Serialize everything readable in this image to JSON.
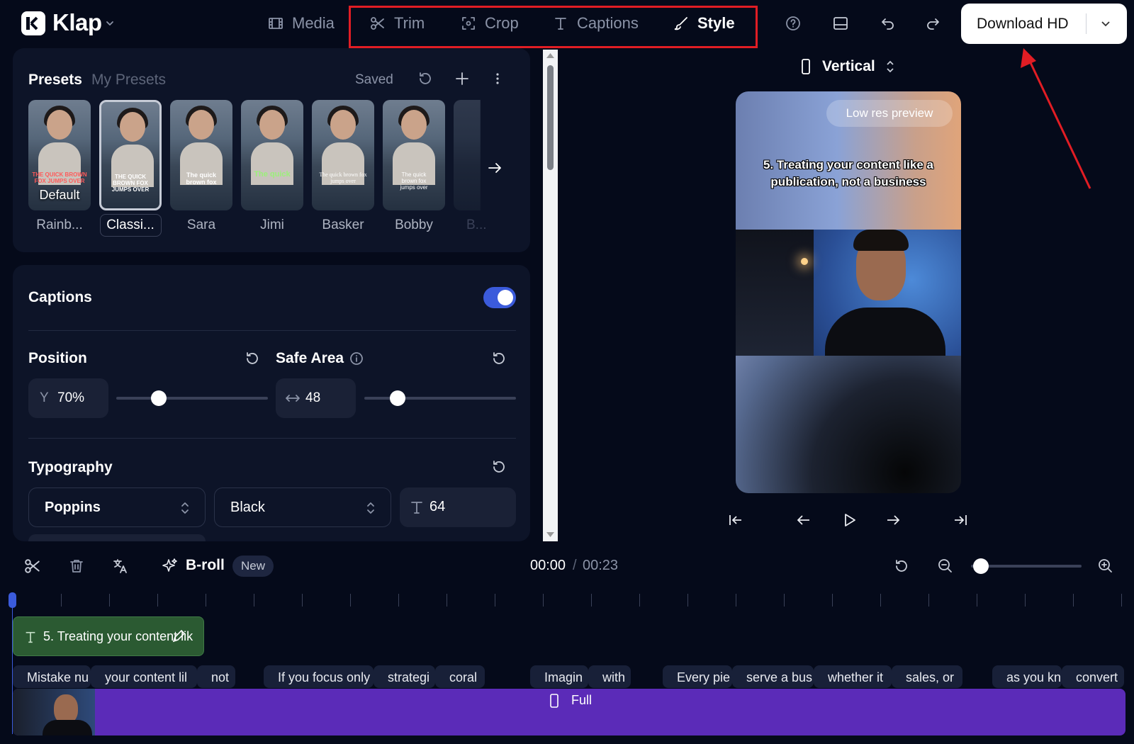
{
  "app": {
    "name": "Klap"
  },
  "nav": {
    "media": "Media",
    "trim": "Trim",
    "crop": "Crop",
    "captions": "Captions",
    "style": "Style"
  },
  "toolbar": {
    "download": "Download HD"
  },
  "presets": {
    "tab_presets": "Presets",
    "tab_my": "My Presets",
    "saved": "Saved",
    "items": [
      {
        "label": "Rainb...",
        "caption": "THE QUICK BROWN FOX JUMPS OVER",
        "badge": "Default"
      },
      {
        "label": "Classi...",
        "caption": "THE QUICK BROWN FOX JUMPS OVER"
      },
      {
        "label": "Sara",
        "caption": "The quick brown fox"
      },
      {
        "label": "Jimi",
        "caption": "The quick"
      },
      {
        "label": "Basker",
        "caption": "The quick brown fox jumps over"
      },
      {
        "label": "Bobby",
        "caption": "The quick brown fox jumps over"
      },
      {
        "label": "B..."
      }
    ]
  },
  "captions_section": {
    "title": "Captions",
    "enabled": true
  },
  "position": {
    "title": "Position",
    "axis": "Y",
    "value": "70%",
    "level": 0.28
  },
  "safe_area": {
    "title": "Safe Area",
    "value": "48",
    "level": 0.22
  },
  "typography": {
    "title": "Typography",
    "font": "Poppins",
    "weight": "Black",
    "size": "64"
  },
  "preview": {
    "orientation": "Vertical",
    "badge": "Low res preview",
    "caption": "5. Treating your content like a publication, not a business"
  },
  "timeline": {
    "broll": "B-roll",
    "new_badge": "New",
    "time_current": "00:00",
    "time_sep": "/",
    "time_total": "00:23",
    "text_clip": "5. Treating your content lik",
    "segments": [
      "Mistake nu",
      "your content lil",
      "not",
      "If you focus only",
      "strategi",
      "coral",
      "Imagin",
      "with",
      "Every pie",
      "serve a bus",
      "whether it",
      "sales, or",
      "as you kn",
      "convert"
    ],
    "video_track": "Full"
  },
  "colors": {
    "accent": "#3b5bdb",
    "track": "#5b2bb8",
    "annotation": "#e11d24"
  }
}
